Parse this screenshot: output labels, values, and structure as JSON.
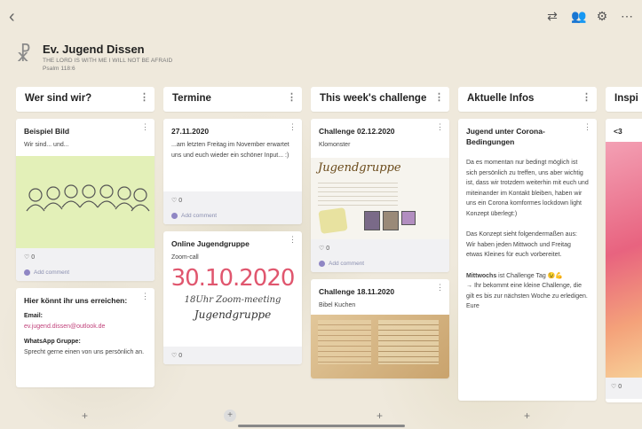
{
  "header": {
    "title": "Ev. Jugend Dissen",
    "subtitle": "THE LORD IS WITH ME I WILL NOT BE AFRAID",
    "subtitle2": "Psalm 118:6"
  },
  "toolbar": {
    "icons": [
      "share-icon",
      "people-icon",
      "settings-icon",
      "more-icon"
    ]
  },
  "columns": [
    {
      "title": "Wer sind wir?",
      "cards": [
        {
          "title": "Beispiel Bild",
          "text": "Wir sind... und...",
          "likes": "0",
          "comment": "Add comment"
        },
        {
          "title": "Hier könnt ihr uns erreichen:",
          "label1": "Email:",
          "email": "ev.jugend.dissen@outlook.de",
          "label2": "WhatsApp Gruppe:",
          "text": "Sprecht gerne einen von uns persönlich an."
        }
      ]
    },
    {
      "title": "Termine",
      "cards": [
        {
          "title": "27.11.2020",
          "text": "...am letzten Freitag im November erwartet uns und euch wieder ein schöner Input... :)",
          "likes": "0",
          "comment": "Add comment"
        },
        {
          "title": "Online Jugendgruppe",
          "text": "Zoom-call",
          "img_date": "30.10.2020",
          "img_line2": "18Uhr Zoom-meeting",
          "img_line3": "Jugendgruppe",
          "likes": "0"
        }
      ]
    },
    {
      "title": "This week's challenge",
      "cards": [
        {
          "title": "Challenge 02.12.2020",
          "text": "Klomonster",
          "img_label": "Jugendgruppe",
          "likes": "0",
          "comment": "Add comment"
        },
        {
          "title": "Challenge 18.11.2020",
          "text": "Bibel Kuchen"
        }
      ]
    },
    {
      "title": "Aktuelle Infos",
      "cards": [
        {
          "title": "Jugend unter Corona-Bedingungen",
          "p1": "Da es momentan nur bedingt möglich ist sich persönlich zu treffen, uns aber wichtig ist, dass wir trotzdem weiterhin mit euch und miteinander im Kontakt bleiben, haben wir uns ein Corona komformes lockdown light Konzept überlegt:)",
          "p2": "Das Konzept sieht folgendermaßen aus:",
          "p3": "Wir haben jeden Mittwoch und Freitag etwas Kleines für euch vorbereitet.",
          "p4_bold": "Mittwochs",
          "p4": " ist Challenge Tag 😉💪",
          "p5": "→ Ihr bekommt eine kleine Challenge, die gilt es bis zur nächsten Woche zu erledigen. Eure"
        }
      ]
    },
    {
      "title": "Inspi",
      "cards": [
        {
          "title": "<3",
          "likes": "0"
        }
      ]
    }
  ]
}
